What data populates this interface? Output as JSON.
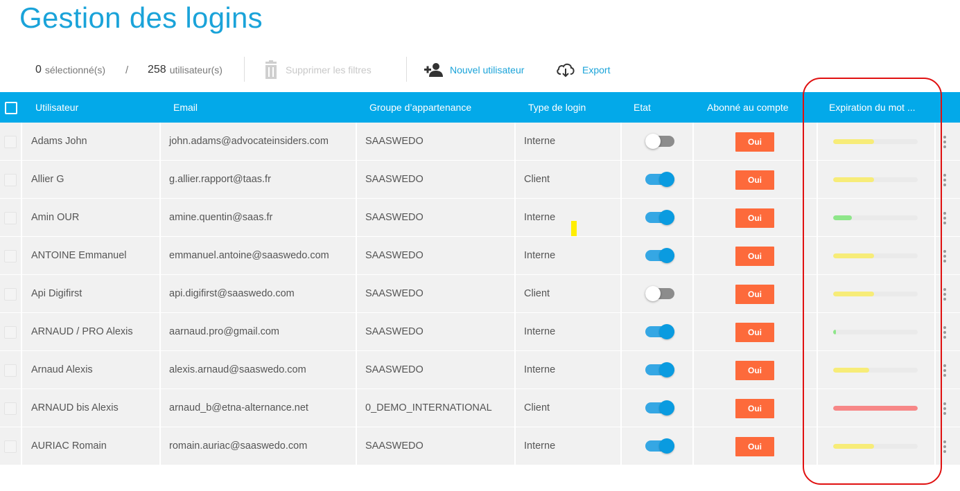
{
  "page": {
    "title": "Gestion des logins"
  },
  "toolbar": {
    "selected_count": "0",
    "selected_label": "sélectionné(s)",
    "separator": "/",
    "users_count": "258",
    "users_label": "utilisateur(s)",
    "clear_filters_label": "Supprimer les filtres",
    "new_user_label": "Nouvel utilisateur",
    "export_label": "Export",
    "icons": [
      "trash-icon",
      "add-user-icon",
      "cloud-download-icon"
    ]
  },
  "table": {
    "columns": [
      "Utilisateur",
      "Email",
      "Groupe d’appartenance",
      "Type de login",
      "Etat",
      "Abonné au compte",
      "Expiration du mot ..."
    ],
    "rows": [
      {
        "user": "Adams John",
        "email": "john.adams@advocateinsiders.com",
        "group": "SAASWEDO",
        "login_type": "Interne",
        "active": false,
        "subscribed": "Oui",
        "expiration": 0.48,
        "expiration_color": "#f7ec78"
      },
      {
        "user": "Allier G",
        "email": "g.allier.rapport@taas.fr",
        "group": "SAASWEDO",
        "login_type": "Client",
        "active": true,
        "subscribed": "Oui",
        "expiration": 0.48,
        "expiration_color": "#f7ec78"
      },
      {
        "user": "Amin OUR",
        "email": "amine.quentin@saas.fr",
        "group": "SAASWEDO",
        "login_type": "Interne",
        "active": true,
        "subscribed": "Oui",
        "expiration": 0.22,
        "expiration_color": "#8ee68a"
      },
      {
        "user": "ANTOINE Emmanuel",
        "email": "emmanuel.antoine@saaswedo.com",
        "group": "SAASWEDO",
        "login_type": "Interne",
        "active": true,
        "subscribed": "Oui",
        "expiration": 0.48,
        "expiration_color": "#f7ec78"
      },
      {
        "user": "Api Digifirst",
        "email": "api.digifirst@saaswedo.com",
        "group": "SAASWEDO",
        "login_type": "Client",
        "active": false,
        "subscribed": "Oui",
        "expiration": 0.48,
        "expiration_color": "#f7ec78"
      },
      {
        "user": "ARNAUD / PRO Alexis",
        "email": "aarnaud.pro@gmail.com",
        "group": "SAASWEDO",
        "login_type": "Interne",
        "active": true,
        "subscribed": "Oui",
        "expiration": 0.03,
        "expiration_color": "#8ee68a"
      },
      {
        "user": "Arnaud Alexis",
        "email": "alexis.arnaud@saaswedo.com",
        "group": "SAASWEDO",
        "login_type": "Interne",
        "active": true,
        "subscribed": "Oui",
        "expiration": 0.43,
        "expiration_color": "#f7ec78"
      },
      {
        "user": "ARNAUD bis Alexis",
        "email": "arnaud_b@etna-alternance.net",
        "group": "0_DEMO_INTERNATIONAL",
        "login_type": "Client",
        "active": true,
        "subscribed": "Oui",
        "expiration": 1.0,
        "expiration_color": "#f78787"
      },
      {
        "user": "AURIAC Romain",
        "email": "romain.auriac@saaswedo.com",
        "group": "SAASWEDO",
        "login_type": "Interne",
        "active": true,
        "subscribed": "Oui",
        "expiration": 0.48,
        "expiration_color": "#f7ec78"
      }
    ]
  },
  "colors": {
    "accent": "#1aa3d9",
    "header_bg": "#03a9e9",
    "badge": "#fd6a3b",
    "highlight": "#e01010",
    "marker": "#ffee00"
  }
}
